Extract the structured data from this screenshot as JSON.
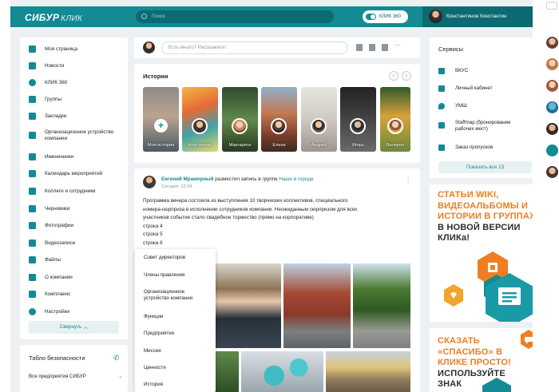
{
  "header": {
    "logo": "СИБУР",
    "logo_sub": "КЛИК",
    "search_placeholder": "Поиск",
    "klik_button": "КЛИК 360",
    "user_name": "Константинов Константин"
  },
  "sidebar": {
    "items": [
      {
        "label": "Моя страница",
        "icon": "home-icon"
      },
      {
        "label": "Новости",
        "icon": "news-icon"
      },
      {
        "label": "КЛИК 360",
        "icon": "klik360-icon"
      },
      {
        "label": "Группы",
        "icon": "groups-icon"
      },
      {
        "label": "Закладки",
        "icon": "bookmark-icon"
      },
      {
        "label": "Организационное устройство компании",
        "icon": "org-structure-icon"
      },
      {
        "label": "Именинники",
        "icon": "birthday-icon"
      },
      {
        "label": "Календарь мероприятий",
        "icon": "calendar-icon"
      },
      {
        "label": "Коллеги и сотрудники",
        "icon": "colleagues-icon"
      },
      {
        "label": "Черновики",
        "icon": "drafts-icon"
      },
      {
        "label": "Фотографии",
        "icon": "photos-icon"
      },
      {
        "label": "Видеозаписи",
        "icon": "videos-icon"
      },
      {
        "label": "Файлы",
        "icon": "files-icon"
      },
      {
        "label": "О компании",
        "icon": "about-icon"
      },
      {
        "label": "Комплаенс",
        "icon": "compliance-icon"
      },
      {
        "label": "Настройки",
        "icon": "settings-icon"
      }
    ],
    "collapse_label": "Свернуть"
  },
  "safety": {
    "title": "Табло безопасности",
    "selector": "Все предприятия СИБУР"
  },
  "composer": {
    "placeholder": "Есть много? Расскажите!"
  },
  "stories": {
    "title": "Истории",
    "items": [
      {
        "name": "Моя история"
      },
      {
        "name": "Константин"
      },
      {
        "name": "Маргарита"
      },
      {
        "name": "Елена"
      },
      {
        "name": "Андрей"
      },
      {
        "name": "Игорь"
      },
      {
        "name": "Валерия"
      }
    ]
  },
  "post": {
    "author": "Евгений Мраморный",
    "action": "разместил запись в группе",
    "group": "Наши в городе",
    "date": "Сегодня, 12:34",
    "lines": [
      "Программа вечера состояла из выступления 10 творческих коллективов, специального",
      "номера-сюрприза в исполнении сотрудников компании. Неожиданным сюрпризом для всех",
      "участников событие стало свадебное торжество (прямо на корпоративе)",
      "строка 4",
      "строка 5",
      "строка 6"
    ]
  },
  "dropdown": {
    "items": [
      "Совет директоров",
      "Члены правления",
      "Организационное устройство компании",
      "Функции",
      "Предприятия",
      "Миссия",
      "Ценности",
      "История"
    ]
  },
  "services": {
    "title": "Сервисы",
    "items": [
      {
        "label": "ВКУС",
        "icon": "food-icon"
      },
      {
        "label": "Личный кабинет",
        "icon": "cabinet-icon"
      },
      {
        "label": "УМШ",
        "icon": "location-icon"
      },
      {
        "label": "Staffmap (бронирование рабочих мест)",
        "icon": "staffmap-icon"
      },
      {
        "label": "Заказ пропусков",
        "icon": "pass-icon"
      }
    ],
    "show_all": "Показать все 13"
  },
  "banner1": {
    "line1": "СТАТЬИ WIKI,",
    "line2": "ВИДЕОАЛЬБОМЫ И",
    "line3": "ИСТОРИИ В ГРУППАХ",
    "line4": "В НОВОЙ ВЕРСИИ",
    "line5": "КЛИКа!"
  },
  "banner2": {
    "line1": "СКАЗАТЬ",
    "line2": "«СПАСИБО» В",
    "line3": "КЛИКЕ ПРОСТО!",
    "line4": "ИСПОЛЬЗУЙТЕ",
    "line5": "ЗНАК"
  },
  "colors": {
    "brand": "#138a94",
    "brand_dark": "#0c6a73",
    "accent": "#f07d1f",
    "background": "#eef1f3"
  }
}
